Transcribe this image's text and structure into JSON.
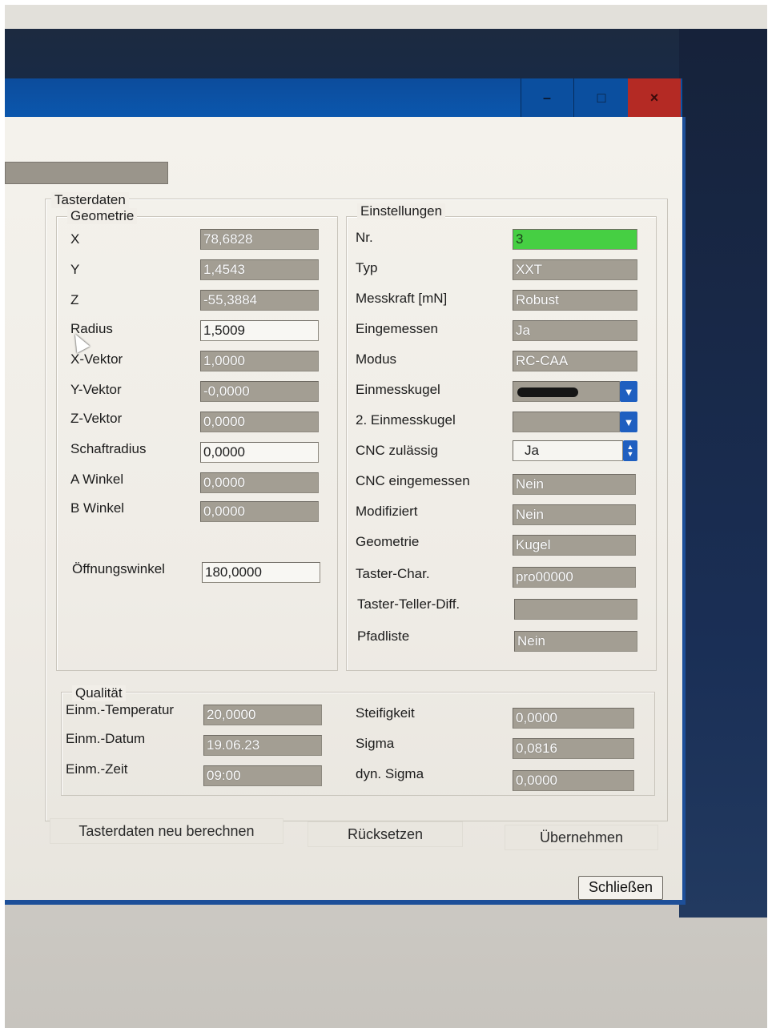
{
  "window_controls": {
    "minimize": "–",
    "maximize": "□",
    "close": "×"
  },
  "tasterdaten": {
    "legend": "Tasterdaten",
    "geometrie": {
      "legend": "Geometrie",
      "rows": [
        {
          "label": "X",
          "value": "78,6828"
        },
        {
          "label": "Y",
          "value": "1,4543"
        },
        {
          "label": "Z",
          "value": "-55,3884"
        },
        {
          "label": "Radius",
          "value": "1,5009"
        },
        {
          "label": "X-Vektor",
          "value": "1,0000"
        },
        {
          "label": "Y-Vektor",
          "value": "-0,0000"
        },
        {
          "label": "Z-Vektor",
          "value": "0,0000"
        },
        {
          "label": "Schaftradius",
          "value": "0,0000"
        },
        {
          "label": "A Winkel",
          "value": "0,0000"
        },
        {
          "label": "B Winkel",
          "value": "0,0000"
        },
        {
          "label": "Öffnungswinkel",
          "value": "180,0000"
        }
      ]
    },
    "einstellungen": {
      "legend": "Einstellungen",
      "rows": [
        {
          "label": "Nr.",
          "value": "3"
        },
        {
          "label": "Typ",
          "value": "XXT"
        },
        {
          "label": "Messkraft [mN]",
          "value": "Robust"
        },
        {
          "label": "Eingemessen",
          "value": "Ja"
        },
        {
          "label": "Modus",
          "value": "RC-CAA"
        },
        {
          "label": "Einmesskugel",
          "value": ""
        },
        {
          "label": "2. Einmesskugel",
          "value": ""
        },
        {
          "label": "CNC zulässig",
          "value": "Ja"
        },
        {
          "label": "CNC eingemessen",
          "value": "Nein"
        },
        {
          "label": "Modifiziert",
          "value": "Nein"
        },
        {
          "label": "Geometrie",
          "value": "Kugel"
        },
        {
          "label": "Taster-Char.",
          "value": "pro00000"
        },
        {
          "label": "Taster-Teller-Diff.",
          "value": ""
        },
        {
          "label": "Pfadliste",
          "value": "Nein"
        }
      ]
    },
    "qualitaet": {
      "legend": "Qualität",
      "left": [
        {
          "label": "Einm.-Temperatur",
          "value": "20,0000"
        },
        {
          "label": "Einm.-Datum",
          "value": "19.06.23"
        },
        {
          "label": "Einm.-Zeit",
          "value": "09:00"
        }
      ],
      "right": [
        {
          "label": "Steifigkeit",
          "value": "0,0000"
        },
        {
          "label": "Sigma",
          "value": "0,0816"
        },
        {
          "label": "dyn. Sigma",
          "value": "0,0000"
        }
      ]
    }
  },
  "actions": {
    "recalc": "Tasterdaten neu berechnen",
    "reset": "Rücksetzen",
    "apply": "Übernehmen",
    "close": "Schließen"
  },
  "colors": {
    "titlebar": "#0b57ad",
    "close": "#b42a24",
    "active_field": "#46cf43",
    "readonly_field": "#a39e93"
  }
}
